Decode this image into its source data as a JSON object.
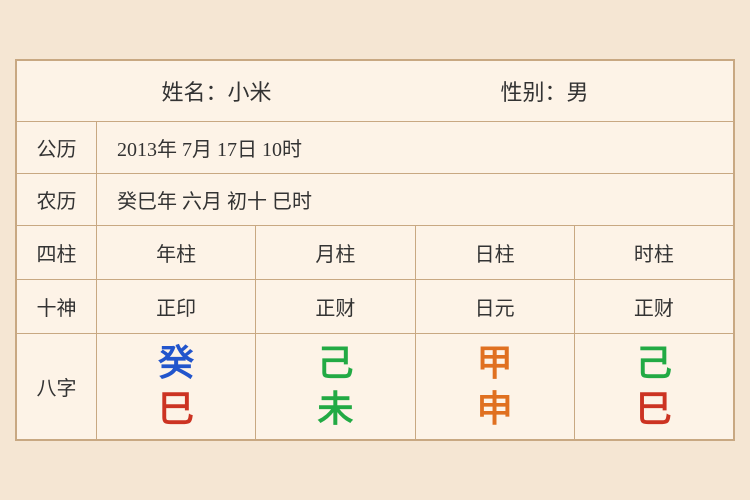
{
  "header": {
    "name_label": "姓名：小米",
    "gender_label": "性别：男"
  },
  "rows": {
    "gregorian_label": "公历",
    "gregorian_value": "2013年 7月 17日 10时",
    "lunar_label": "农历",
    "lunar_value": "癸巳年 六月 初十 巳时",
    "sizhu_label": "四柱",
    "sizhu_cols": [
      "年柱",
      "月柱",
      "日柱",
      "时柱"
    ],
    "shishen_label": "十神",
    "shishen_cols": [
      "正印",
      "正财",
      "日元",
      "正财"
    ],
    "bazhi_label": "八字",
    "bazhi_cols": [
      {
        "top": "癸",
        "bottom": "巳",
        "top_color": "blue",
        "bottom_color": "red"
      },
      {
        "top": "己",
        "bottom": "未",
        "top_color": "green",
        "bottom_color": "green"
      },
      {
        "top": "甲",
        "bottom": "申",
        "top_color": "orange",
        "bottom_color": "orange"
      },
      {
        "top": "己",
        "bottom": "巳",
        "top_color": "green",
        "bottom_color": "red"
      }
    ]
  }
}
